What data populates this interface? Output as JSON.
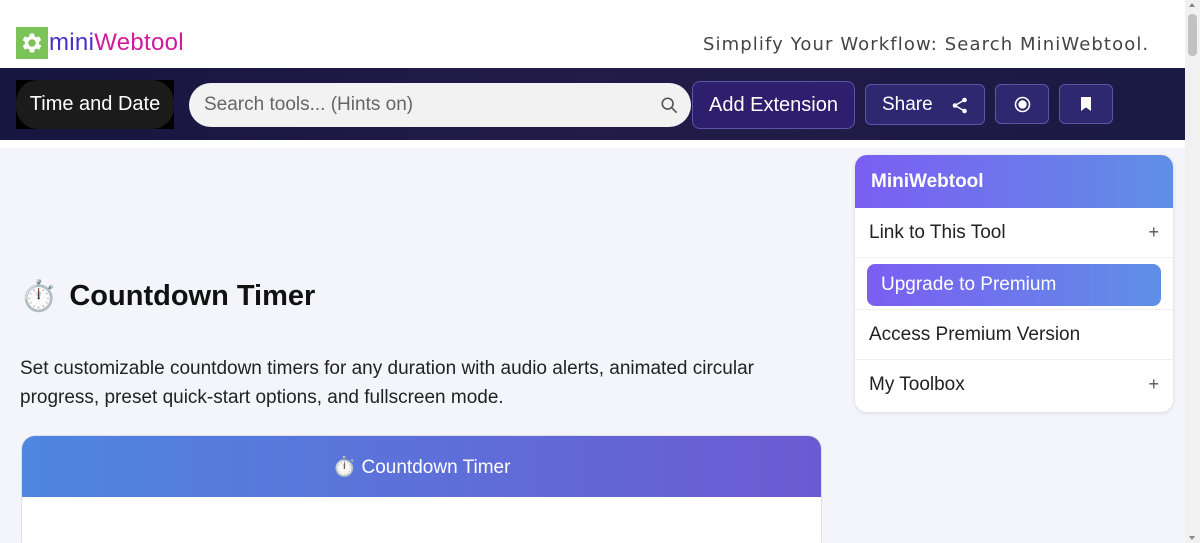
{
  "header": {
    "logo_part1": "mini",
    "logo_part2": "Webtool",
    "logo_icon": "gear-icon",
    "tagline": "Simplify Your Workflow: Search MiniWebtool."
  },
  "nav": {
    "category_label": "Time and Date",
    "search_placeholder": "Search tools... (Hints on)",
    "search_icon": "search-icon",
    "add_extension_label": "Add Extension",
    "share_label": "Share",
    "share_icon": "share-icon",
    "record_icon": "record-icon",
    "bookmark_icon": "bookmark-icon"
  },
  "main": {
    "title_emoji": "⏱️",
    "title": "Countdown Timer",
    "description": "Set customizable countdown timers for any duration with audio alerts, animated circular progress, preset quick-start options, and fullscreen mode.",
    "card_title": "⏱️ Countdown Timer"
  },
  "sidebar": {
    "heading": "MiniWebtool",
    "items": [
      {
        "label": "Link to This Tool",
        "expand": "+"
      },
      {
        "label": "Upgrade to Premium"
      },
      {
        "label": "Access Premium Version"
      },
      {
        "label": "My Toolbox",
        "expand": "+"
      }
    ]
  },
  "colors": {
    "nav_bg": "#1a1a44",
    "logo_mini": "#4b2fc9",
    "logo_web": "#d11a9b",
    "logo_gear_bg": "#7cc35a",
    "accent_gradient_start": "#7b5ef2",
    "accent_gradient_end": "#5f8fe6"
  }
}
